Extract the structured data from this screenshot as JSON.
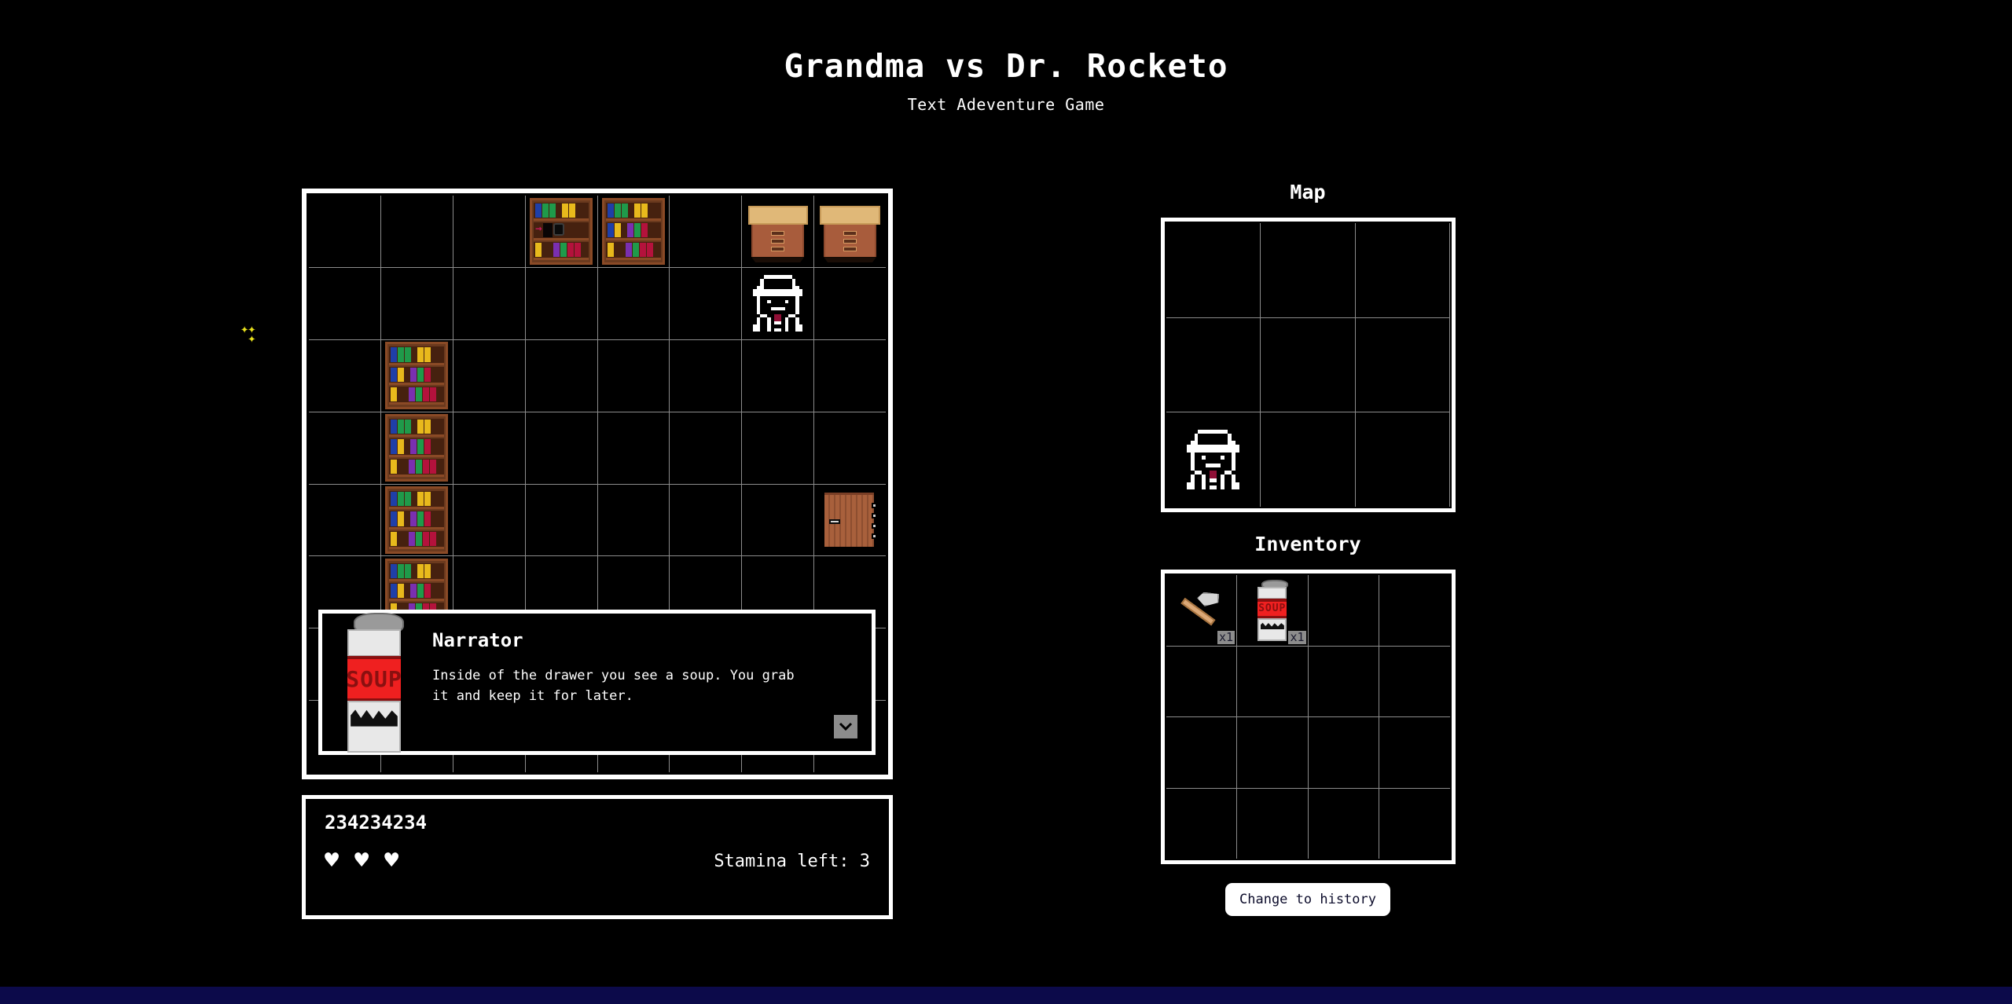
{
  "header": {
    "title": "Grandma vs Dr. Rocketo",
    "subtitle": "Text Adeventure Game"
  },
  "board": {
    "columns": 8,
    "rows": 8,
    "sparkle_glyph": "✦✦\n ✦",
    "tiles": [
      {
        "row": 0,
        "col": 3,
        "type": "bookshelf-special"
      },
      {
        "row": 0,
        "col": 4,
        "type": "bookshelf"
      },
      {
        "row": 0,
        "col": 6,
        "type": "dresser"
      },
      {
        "row": 0,
        "col": 7,
        "type": "dresser"
      },
      {
        "row": 1,
        "col": 6,
        "type": "player"
      },
      {
        "row": 2,
        "col": 1,
        "type": "bookshelf"
      },
      {
        "row": 3,
        "col": 1,
        "type": "bookshelf"
      },
      {
        "row": 4,
        "col": 1,
        "type": "bookshelf"
      },
      {
        "row": 4,
        "col": 7,
        "type": "door"
      },
      {
        "row": 5,
        "col": 1,
        "type": "bookshelf"
      },
      {
        "row": 6,
        "col": 3,
        "type": "bookshelf"
      },
      {
        "row": 6,
        "col": 4,
        "type": "bookshelf"
      }
    ]
  },
  "dialog": {
    "speaker": "Narrator",
    "text": "Inside of the drawer you see a soup. You grab it and keep it for later.",
    "portrait_item": "soup-can",
    "next_glyph": "⌄"
  },
  "status": {
    "player_name": "234234234",
    "hearts": 3,
    "heart_glyph": "♥",
    "stamina_label": "Stamina left: 3"
  },
  "map": {
    "title": "Map",
    "columns": 3,
    "rows": 3,
    "player_row": 2,
    "player_col": 0
  },
  "inventory": {
    "title": "Inventory",
    "columns": 4,
    "rows": 4,
    "slots": [
      {
        "index": 0,
        "item": "axe",
        "count": "x1"
      },
      {
        "index": 1,
        "item": "soup-can",
        "count": "x1"
      }
    ]
  },
  "controls": {
    "history_button": "Change to history"
  },
  "colors": {
    "background": "#000000",
    "panel_border": "#ffffff",
    "grid_line": "#8c8c8c",
    "accent_red": "#ef2020",
    "bowtie": "#8f0f36",
    "sparkle": "#e8e01c",
    "taskbar": "#0c0a4a",
    "soup_label_text": "SOUP"
  }
}
